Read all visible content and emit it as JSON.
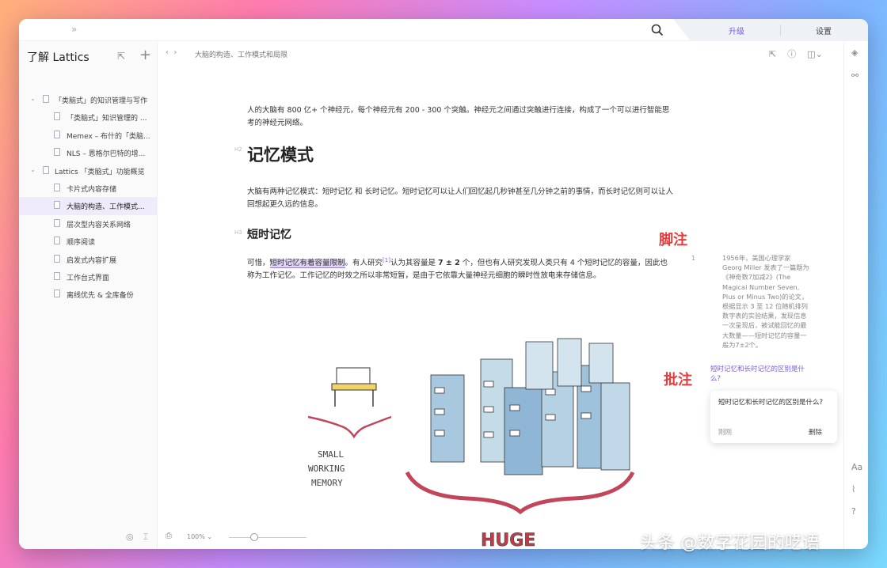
{
  "topbar": {
    "collapse_icon": "»",
    "tab_upgrade": "升级",
    "tab_settings": "设置"
  },
  "sidebar": {
    "title": "了解 Lattics",
    "items": [
      {
        "label": "「类脑式」的知识管理与写作",
        "level": 0,
        "expanded": true
      },
      {
        "label": "「类脑式」知识管理的 ...",
        "level": 1
      },
      {
        "label": "Memex – 布什的「类脑...",
        "level": 1
      },
      {
        "label": "NLS – 恩格尔巴特的增...",
        "level": 1
      },
      {
        "label": "Lattics 「类脑式」功能概览",
        "level": 0,
        "expanded": true
      },
      {
        "label": "卡片式内容存储",
        "level": 1
      },
      {
        "label": "大脑的构造、工作模式...",
        "level": 1,
        "active": true
      },
      {
        "label": "层次型内容关系网络",
        "level": 1
      },
      {
        "label": "顺序阅读",
        "level": 1
      },
      {
        "label": "启发式内容扩展",
        "level": 1
      },
      {
        "label": "工作台式界面",
        "level": 1
      },
      {
        "label": "离线优先 & 全库备份",
        "level": 1
      }
    ]
  },
  "breadcrumb": "大脑的构造、工作模式和局限",
  "doc": {
    "para1": "人的大脑有 800 亿+ 个神经元，每个神经元有 200 - 300 个突触。神经元之间通过突触进行连接，构成了一个可以进行智能思考的神经元网络。",
    "h2": "记忆模式",
    "h2_mark": "H2",
    "para2": "大脑有两种记忆模式：短时记忆 和 长时记忆。短时记忆可以让人们回忆起几秒钟甚至几分钟之前的事情，而长时记忆则可以让人回想起更久远的信息。",
    "h3": "短时记忆",
    "h3_mark": "H3",
    "para3_a": "可惜，",
    "para3_hl": "短时记忆有着容量限制",
    "para3_b": "。有人研究",
    "fn_ref": "[1]",
    "para3_c": "认为其容量是 ",
    "para3_math": "7 ± 2",
    "para3_d": " 个，但也有人研究发现人类只有 4 个短时记忆的容量，因此也称为工作记忆。工作记忆的时效之所以非常短暂，是由于它依靠大量神经元细胞的瞬时性放电来存储信息。",
    "sketch_small": "SMALL",
    "sketch_working": "WORKING",
    "sketch_memory": "MEMORY",
    "sketch_huge": "HUGE"
  },
  "footnote": {
    "num": "1",
    "text": "1956年，美国心理学家 Georg Miller 发表了一篇题为《神奇数7加减2》(The Magical Number Seven, Plus or Minus Two)的论文，根据显示 3 至 12 位随机排列数字表的实验结果，发现信息一次呈现后，被试能回忆的最大数量——短时记忆的容量一般为7±2个。"
  },
  "comment": {
    "anchor": "短时记忆和长时记忆的区别是什么?",
    "text": "短时记忆和长时记忆的区别是什么?",
    "time": "刚刚",
    "delete_label": "删除"
  },
  "annotations": {
    "footnote_label": "脚注",
    "comment_label": "批注"
  },
  "bottombar": {
    "zoom": "100% ⌄"
  },
  "rail": {
    "font_label": "Aa",
    "help_label": "?"
  },
  "watermark": "头条 @数字花园的呓语"
}
